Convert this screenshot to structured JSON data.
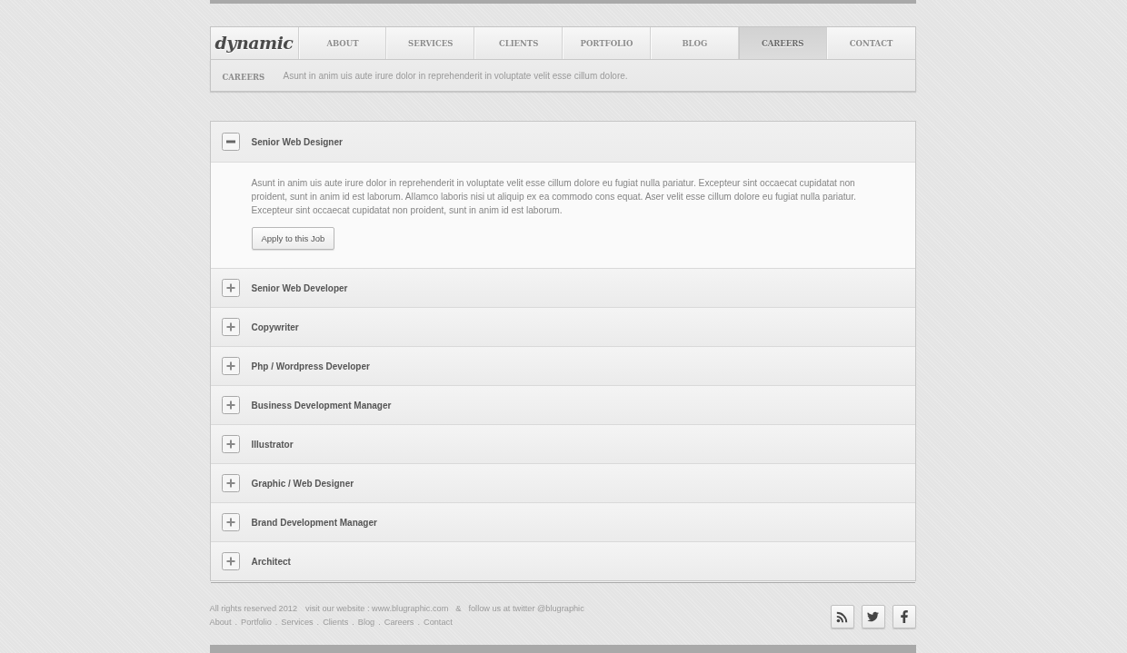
{
  "nav": {
    "logo": "dynamic",
    "tabs": [
      {
        "label": "ABOUT",
        "selected": false
      },
      {
        "label": "SERVICES",
        "selected": false
      },
      {
        "label": "CLIENTS",
        "selected": false
      },
      {
        "label": "PORTFOLIO",
        "selected": false
      },
      {
        "label": "BLOG",
        "selected": false
      },
      {
        "label": "CAREERS",
        "selected": true
      },
      {
        "label": "CONTACT",
        "selected": false
      }
    ]
  },
  "subheader": {
    "label": "CAREERS",
    "text": "Asunt in anim uis aute irure dolor in reprehenderit in voluptate velit esse cillum dolore."
  },
  "jobs": [
    {
      "title": "Senior Web Designer",
      "expanded": true,
      "description": "Asunt in anim uis aute irure dolor in reprehenderit in voluptate velit esse cillum dolore eu fugiat nulla pariatur. Excepteur sint occaecat cupidatat non proident, sunt in anim id est laborum. Allamco laboris nisi ut aliquip ex ea commodo cons equat. Aser velit esse cillum dolore eu fugiat nulla pariatur. Excepteur sint occaecat cupidatat non proident, sunt in anim id est laborum.",
      "button": "Apply to this Job"
    },
    {
      "title": "Senior Web Developer",
      "expanded": false
    },
    {
      "title": "Copywriter",
      "expanded": false
    },
    {
      "title": "Php / Wordpress Developer",
      "expanded": false
    },
    {
      "title": "Business Development Manager",
      "expanded": false
    },
    {
      "title": "Illustrator",
      "expanded": false
    },
    {
      "title": "Graphic / Web Designer",
      "expanded": false
    },
    {
      "title": "Brand Development Manager",
      "expanded": false
    },
    {
      "title": "Architect",
      "expanded": false
    }
  ],
  "footer": {
    "copyright": [
      "All rights reserved 2012",
      "visit our website : www.blugraphic.com",
      "&",
      "follow us at twitter @blugraphic"
    ],
    "links": [
      {
        "label": "About",
        "separator": "."
      },
      {
        "label": "Portfolio",
        "separator": "."
      },
      {
        "label": "Services",
        "separator": "."
      },
      {
        "label": "Clients",
        "separator": "."
      },
      {
        "label": "Blog",
        "separator": "."
      },
      {
        "label": "Careers",
        "separator": "."
      },
      {
        "label": "Contact"
      }
    ],
    "social": [
      {
        "kind": "rss"
      },
      {
        "kind": "twitter"
      },
      {
        "kind": "facebook"
      }
    ]
  }
}
